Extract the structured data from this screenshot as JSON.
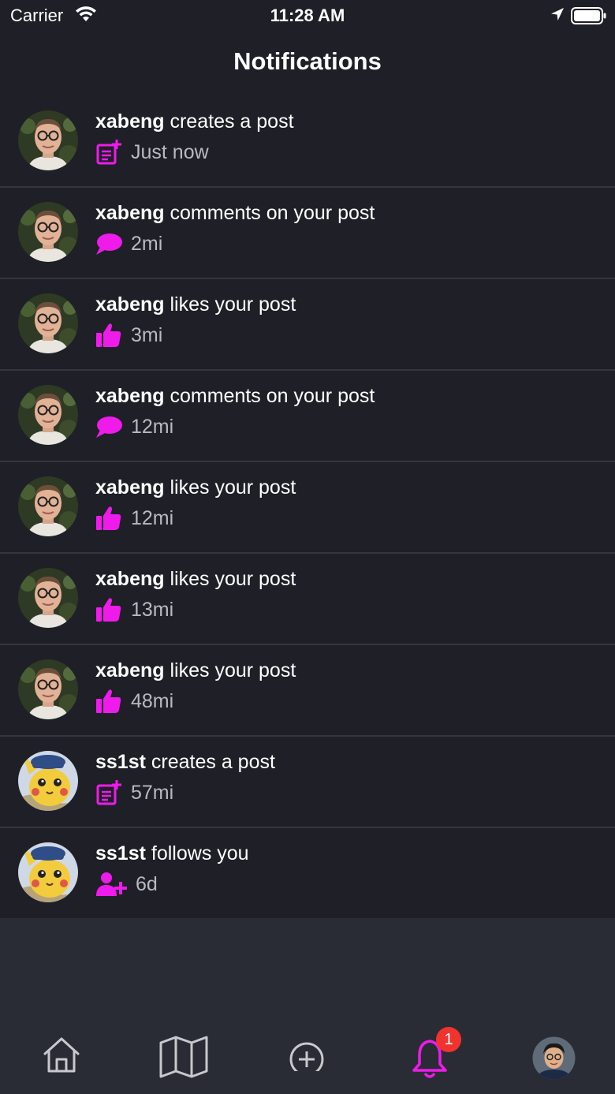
{
  "status_bar": {
    "carrier": "Carrier",
    "time": "11:28 AM"
  },
  "header": {
    "title": "Notifications"
  },
  "colors": {
    "accent": "#ee1bea",
    "badge": "#f0332e",
    "background": "#1f2027"
  },
  "notifications": [
    {
      "user": "xabeng",
      "action": "creates a post",
      "time": "Just now",
      "icon": "create-post-icon",
      "avatar": "man-glasses-avatar"
    },
    {
      "user": "xabeng",
      "action": "comments on your post",
      "time": "2mi",
      "icon": "comment-icon",
      "avatar": "man-glasses-avatar"
    },
    {
      "user": "xabeng",
      "action": "likes your post",
      "time": "3mi",
      "icon": "thumbs-up-icon",
      "avatar": "man-glasses-avatar"
    },
    {
      "user": "xabeng",
      "action": "comments on your post",
      "time": "12mi",
      "icon": "comment-icon",
      "avatar": "man-glasses-avatar"
    },
    {
      "user": "xabeng",
      "action": "likes your post",
      "time": "12mi",
      "icon": "thumbs-up-icon",
      "avatar": "man-glasses-avatar"
    },
    {
      "user": "xabeng",
      "action": "likes your post",
      "time": "13mi",
      "icon": "thumbs-up-icon",
      "avatar": "man-glasses-avatar"
    },
    {
      "user": "xabeng",
      "action": "likes your post",
      "time": "48mi",
      "icon": "thumbs-up-icon",
      "avatar": "man-glasses-avatar"
    },
    {
      "user": "ss1st",
      "action": "creates a post",
      "time": "57mi",
      "icon": "create-post-icon",
      "avatar": "pikachu-avatar"
    },
    {
      "user": "ss1st",
      "action": "follows you",
      "time": "6d",
      "icon": "follow-icon",
      "avatar": "pikachu-avatar"
    }
  ],
  "tabbar": {
    "items": [
      {
        "name": "home",
        "icon": "home-icon"
      },
      {
        "name": "map",
        "icon": "map-icon"
      },
      {
        "name": "add",
        "icon": "plus-circle-icon"
      },
      {
        "name": "notifications",
        "icon": "bell-icon",
        "active": true
      },
      {
        "name": "profile",
        "icon": "profile-avatar"
      }
    ],
    "notifications_badge": "1"
  }
}
